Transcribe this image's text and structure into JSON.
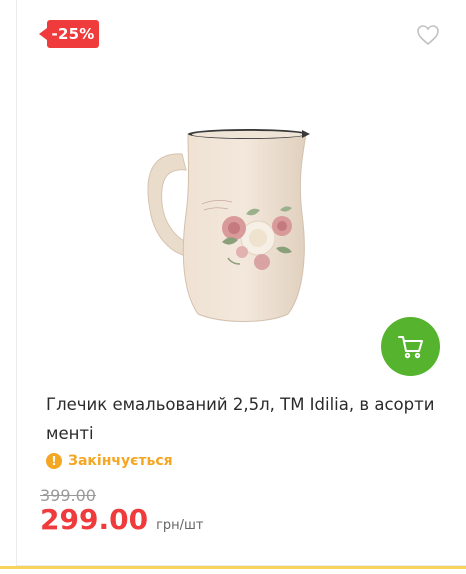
{
  "product": {
    "discount_badge": "-25%",
    "title": "Глечик емальований 2,5л, ТМ Idilia, в асорти менті",
    "stock_status": "Закінчується",
    "old_price": "399.00",
    "price": "299.00",
    "price_unit": "грн/шт"
  },
  "icons": {
    "wishlist": "heart-outline-icon",
    "cart": "cart-icon",
    "stock": "exclamation-circle-icon"
  },
  "colors": {
    "badge": "#ef3b3b",
    "cart_button": "#55b32e",
    "stock_warning": "#f5a623",
    "price": "#ef3b3b"
  }
}
